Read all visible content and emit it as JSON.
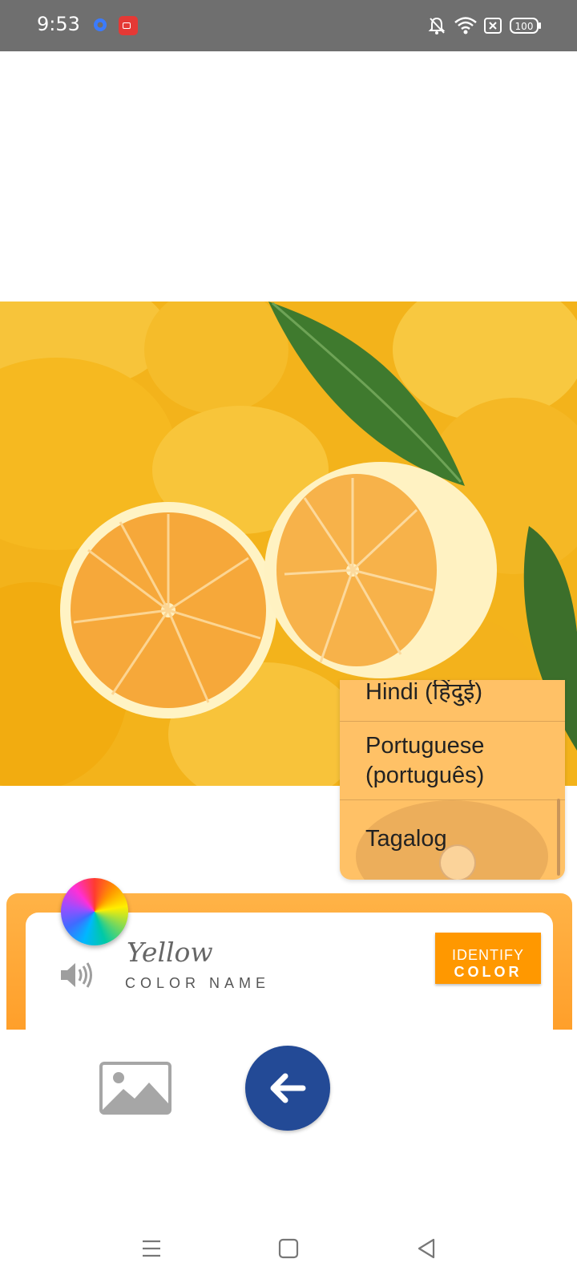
{
  "status_bar": {
    "time": "9:53",
    "icons": [
      "settings-icon",
      "screen-record-icon",
      "bell-off-icon",
      "wifi-icon",
      "sim-off-icon",
      "battery-icon"
    ],
    "battery_level": "100"
  },
  "image": {
    "subject_icon": "lemons-photo"
  },
  "language_dropdown": {
    "items": [
      "Hindi (हिंदुई)",
      "Portuguese (português)",
      "Tagalog"
    ],
    "selected": "Tagalog",
    "background_color": "#ffc166"
  },
  "color_card": {
    "color_name": "Yellow",
    "label": "COLOR NAME",
    "identify_button": {
      "line1": "IDENTIFY",
      "line2": "COLOR"
    },
    "accent_color": "#ff9800"
  },
  "actions": {
    "gallery_icon": "image-icon",
    "back_icon": "arrow-left-icon",
    "back_color": "#234a96"
  },
  "nav_bar": {
    "icons": [
      "menu-icon",
      "home-icon",
      "back-icon"
    ]
  }
}
